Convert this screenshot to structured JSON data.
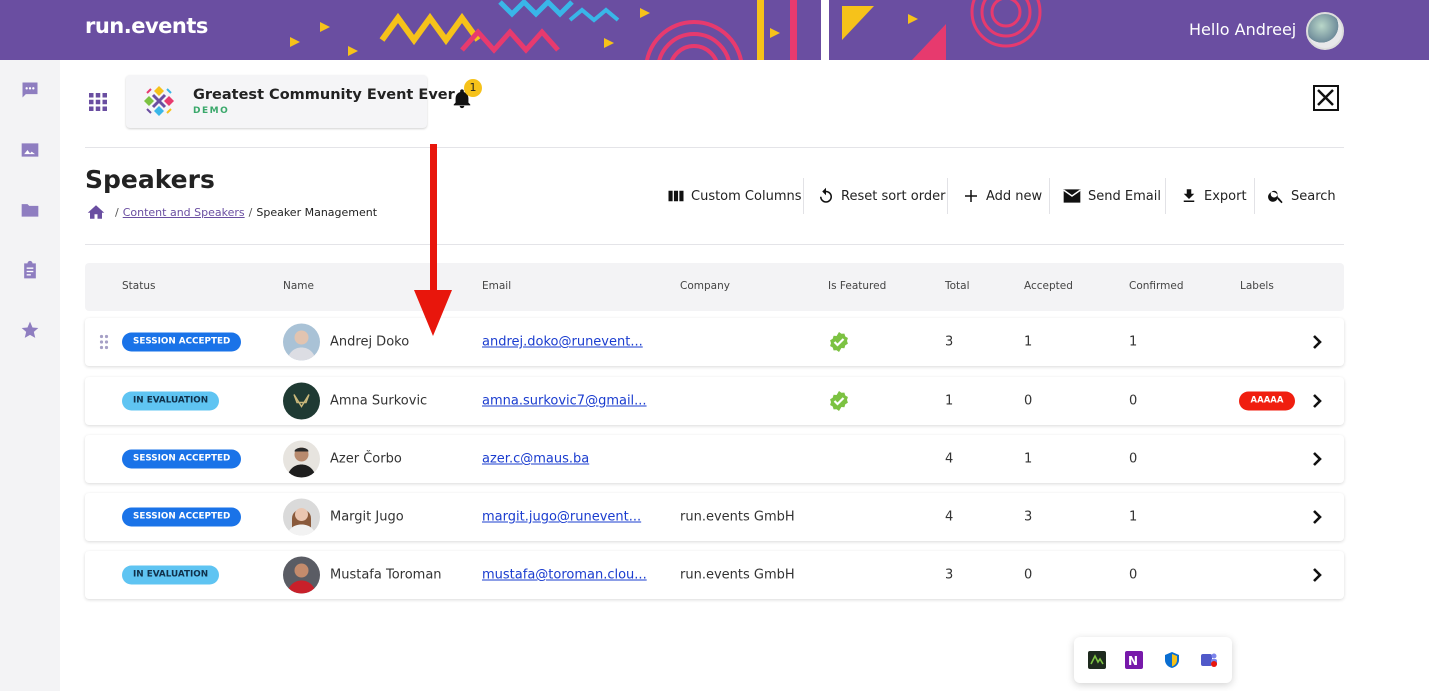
{
  "app": {
    "logo": "run.events",
    "greeting": "Hello Andreej"
  },
  "event": {
    "title": "Greatest Community Event Ever",
    "subtitle": "DEMO",
    "notifications": "1"
  },
  "page": {
    "title": "Speakers",
    "breadcrumb": {
      "link": "Content and Speakers",
      "current": "Speaker Management",
      "sep1": "/",
      "sep2": "/"
    }
  },
  "toolbar": {
    "custom_columns": "Custom Columns",
    "reset_sort": "Reset sort order",
    "add_new": "Add new",
    "send_email": "Send Email",
    "export": "Export",
    "search": "Search"
  },
  "table": {
    "columns": [
      "Status",
      "Name",
      "Email",
      "Company",
      "Is Featured",
      "Total",
      "Accepted",
      "Confirmed",
      "Labels"
    ],
    "rows": [
      {
        "status": "SESSION ACCEPTED",
        "status_kind": "accepted",
        "name": "Andrej Doko",
        "email": "andrej.doko@runevent...",
        "company": "",
        "featured": true,
        "total": "3",
        "accepted": "1",
        "confirmed": "1",
        "label": ""
      },
      {
        "status": "IN EVALUATION",
        "status_kind": "eval",
        "name": "Amna Surkovic",
        "email": "amna.surkovic7@gmail...",
        "company": "",
        "featured": true,
        "total": "1",
        "accepted": "0",
        "confirmed": "0",
        "label": "AAAAA"
      },
      {
        "status": "SESSION ACCEPTED",
        "status_kind": "accepted",
        "name": "Azer Čorbo",
        "email": "azer.c@maus.ba",
        "company": "",
        "featured": false,
        "total": "4",
        "accepted": "1",
        "confirmed": "0",
        "label": ""
      },
      {
        "status": "SESSION ACCEPTED",
        "status_kind": "accepted",
        "name": "Margit Jugo",
        "email": "margit.jugo@runevent...",
        "company": "run.events GmbH",
        "featured": false,
        "total": "4",
        "accepted": "3",
        "confirmed": "1",
        "label": ""
      },
      {
        "status": "IN EVALUATION",
        "status_kind": "eval",
        "name": "Mustafa Toroman",
        "email": "mustafa@toroman.clou...",
        "company": "run.events GmbH",
        "featured": false,
        "total": "3",
        "accepted": "0",
        "confirmed": "0",
        "label": ""
      }
    ]
  },
  "colors": {
    "brand": "#6a4ea1",
    "accepted": "#1a73e8",
    "evaluation": "#5fc4f2",
    "label": "#f01e0f",
    "featured": "#7cc242",
    "annotation": "#e8160c"
  }
}
